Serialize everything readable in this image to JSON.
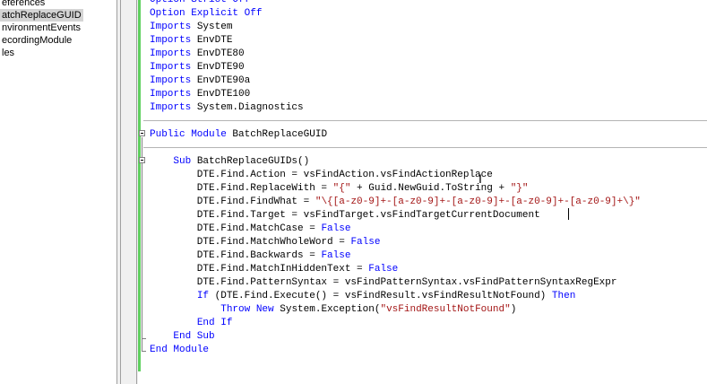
{
  "explorer": {
    "items": [
      {
        "label": "eferences",
        "selected": false
      },
      {
        "label": "atchReplaceGUID",
        "selected": true
      },
      {
        "label": "nvironmentEvents",
        "selected": false
      },
      {
        "label": "ecordingModule",
        "selected": false
      },
      {
        "label": "les",
        "selected": false
      }
    ]
  },
  "code": {
    "lines": [
      [
        {
          "t": "Option Strict Off",
          "c": "kw"
        }
      ],
      [
        {
          "t": "Option Explicit Off",
          "c": "kw"
        }
      ],
      [
        {
          "t": "Imports",
          "c": "kw"
        },
        {
          "t": " System"
        }
      ],
      [
        {
          "t": "Imports",
          "c": "kw"
        },
        {
          "t": " EnvDTE"
        }
      ],
      [
        {
          "t": "Imports",
          "c": "kw"
        },
        {
          "t": " EnvDTE80"
        }
      ],
      [
        {
          "t": "Imports",
          "c": "kw"
        },
        {
          "t": " EnvDTE90"
        }
      ],
      [
        {
          "t": "Imports",
          "c": "kw"
        },
        {
          "t": " EnvDTE90a"
        }
      ],
      [
        {
          "t": "Imports",
          "c": "kw"
        },
        {
          "t": " EnvDTE100"
        }
      ],
      [
        {
          "t": "Imports",
          "c": "kw"
        },
        {
          "t": " System.Diagnostics"
        }
      ],
      [],
      [
        {
          "t": "Public Module",
          "c": "kw"
        },
        {
          "t": " BatchReplaceGUID"
        }
      ],
      [],
      [
        {
          "t": "    "
        },
        {
          "t": "Sub",
          "c": "kw"
        },
        {
          "t": " BatchReplaceGUIDs()"
        }
      ],
      [
        {
          "t": "        DTE.Find.Action = vsFindAction.vsFindActionReplace"
        }
      ],
      [
        {
          "t": "        DTE.Find.ReplaceWith = "
        },
        {
          "t": "\"{\"",
          "c": "str"
        },
        {
          "t": " + Guid.NewGuid.ToString + "
        },
        {
          "t": "\"}\"",
          "c": "str"
        }
      ],
      [
        {
          "t": "        DTE.Find.FindWhat = "
        },
        {
          "t": "\"\\{[a-z0-9]+-[a-z0-9]+-[a-z0-9]+-[a-z0-9]+-[a-z0-9]+\\}\"",
          "c": "str"
        }
      ],
      [
        {
          "t": "        DTE.Find.Target = vsFindTarget.vsFindTargetCurrentDocument"
        }
      ],
      [
        {
          "t": "        DTE.Find.MatchCase = "
        },
        {
          "t": "False",
          "c": "kw"
        }
      ],
      [
        {
          "t": "        DTE.Find.MatchWholeWord = "
        },
        {
          "t": "False",
          "c": "kw"
        }
      ],
      [
        {
          "t": "        DTE.Find.Backwards = "
        },
        {
          "t": "False",
          "c": "kw"
        }
      ],
      [
        {
          "t": "        DTE.Find.MatchInHiddenText = "
        },
        {
          "t": "False",
          "c": "kw"
        }
      ],
      [
        {
          "t": "        DTE.Find.PatternSyntax = vsFindPatternSyntax.vsFindPatternSyntaxRegExpr"
        }
      ],
      [
        {
          "t": "        "
        },
        {
          "t": "If",
          "c": "kw"
        },
        {
          "t": " (DTE.Find.Execute() = vsFindResult.vsFindResultNotFound) "
        },
        {
          "t": "Then",
          "c": "kw"
        }
      ],
      [
        {
          "t": "            "
        },
        {
          "t": "Throw New",
          "c": "kw"
        },
        {
          "t": " System.Exception("
        },
        {
          "t": "\"vsFindResultNotFound\"",
          "c": "str"
        },
        {
          "t": ")"
        }
      ],
      [
        {
          "t": "        "
        },
        {
          "t": "End If",
          "c": "kw"
        }
      ],
      [
        {
          "t": "    "
        },
        {
          "t": "End Sub",
          "c": "kw"
        }
      ],
      [
        {
          "t": "End Module",
          "c": "kw"
        }
      ]
    ]
  },
  "colors": {
    "keyword": "#0000ff",
    "string": "#a31515",
    "changed_margin": "#5fd05f"
  }
}
